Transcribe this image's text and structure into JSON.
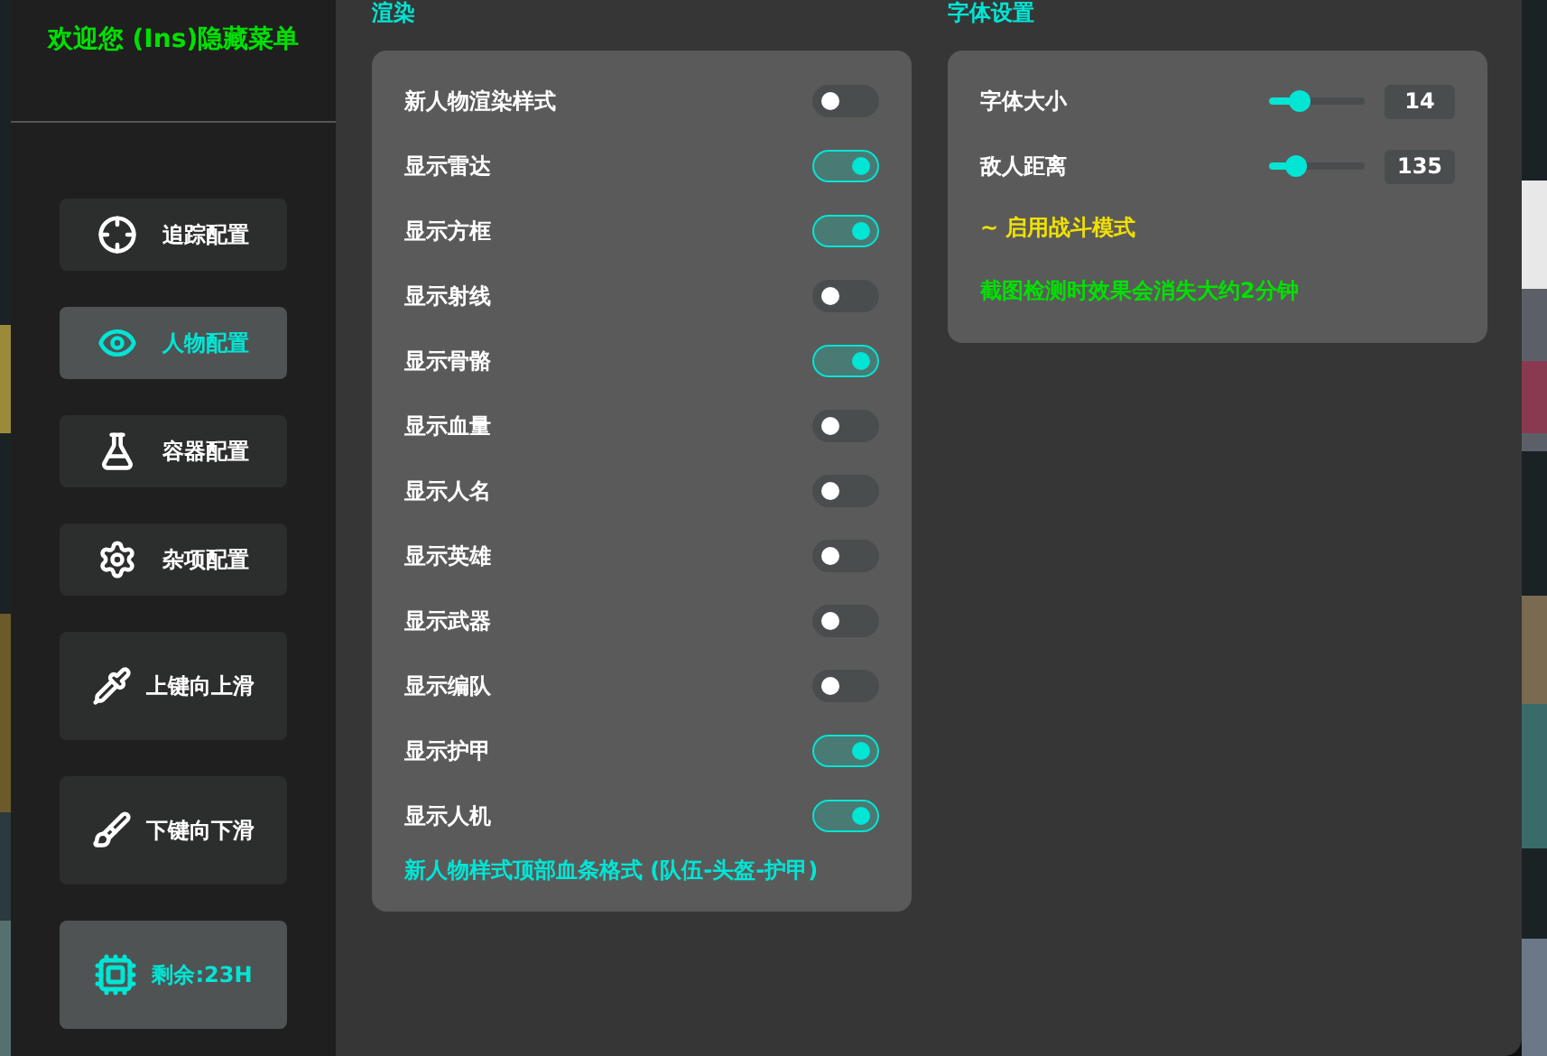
{
  "sidebar": {
    "title": "欢迎您 (Ins)隐藏菜单",
    "items": [
      {
        "label": "追踪配置",
        "selected": false,
        "kind": "short"
      },
      {
        "label": "人物配置",
        "selected": true,
        "kind": "short"
      },
      {
        "label": "容器配置",
        "selected": false,
        "kind": "short"
      },
      {
        "label": "杂项配置",
        "selected": false,
        "kind": "short"
      },
      {
        "label": "上键向上滑",
        "selected": false,
        "kind": "tall"
      },
      {
        "label": "下键向下滑",
        "selected": false,
        "kind": "tall"
      }
    ],
    "status": {
      "label": "剩余:23H"
    }
  },
  "render": {
    "heading": "渲染",
    "toggles": [
      {
        "label": "新人物渲染样式",
        "on": false
      },
      {
        "label": "显示雷达",
        "on": true
      },
      {
        "label": "显示方框",
        "on": true
      },
      {
        "label": "显示射线",
        "on": false
      },
      {
        "label": "显示骨骼",
        "on": true
      },
      {
        "label": "显示血量",
        "on": false
      },
      {
        "label": "显示人名",
        "on": false
      },
      {
        "label": "显示英雄",
        "on": false
      },
      {
        "label": "显示武器",
        "on": false
      },
      {
        "label": "显示编队",
        "on": false
      },
      {
        "label": "显示护甲",
        "on": true
      },
      {
        "label": "显示人机",
        "on": true
      }
    ],
    "note": "新人物样式顶部血条格式 (队伍-头盔-护甲)"
  },
  "font": {
    "heading": "字体设置",
    "sliders": [
      {
        "label": "字体大小",
        "level": 0.32,
        "reading": "14"
      },
      {
        "label": "敌人距离",
        "level": 0.28,
        "reading": "135"
      }
    ],
    "combat_mode": "~ 启用战斗模式",
    "warning": "截图检测时效果会消失大约2分钟"
  }
}
